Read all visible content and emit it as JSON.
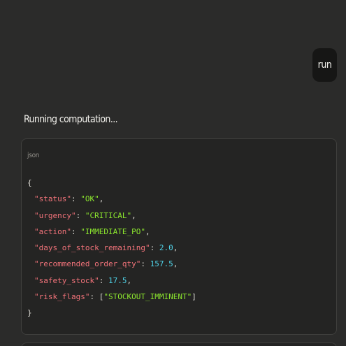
{
  "user_message": {
    "text": "run"
  },
  "assistant": {
    "status_text": "Running computation..."
  },
  "code_block": {
    "language": "json",
    "open_brace": "{",
    "close_brace": "}",
    "lines": [
      {
        "key": "\"status\"",
        "value": "\"OK\"",
        "value_type": "string",
        "trailer": ","
      },
      {
        "key": "\"urgency\"",
        "value": "\"CRITICAL\"",
        "value_type": "string",
        "trailer": ","
      },
      {
        "key": "\"action\"",
        "value": "\"IMMEDIATE_PO\"",
        "value_type": "string",
        "trailer": ","
      },
      {
        "key": "\"days_of_stock_remaining\"",
        "value": "2.0",
        "value_type": "number",
        "trailer": ","
      },
      {
        "key": "\"recommended_order_qty\"",
        "value": "157.5",
        "value_type": "number",
        "trailer": ","
      },
      {
        "key": "\"safety_stock\"",
        "value": "17.5",
        "value_type": "number",
        "trailer": ","
      },
      {
        "key": "\"risk_flags\"",
        "value": "\"STOCKOUT_IMMINENT\"",
        "value_type": "array",
        "trailer": ""
      }
    ]
  },
  "colors": {
    "background": "#2b2b2a",
    "bubble": "#161615",
    "json_key": "#f2737a",
    "json_string": "#8ce62e",
    "json_number": "#4fd3e8"
  }
}
